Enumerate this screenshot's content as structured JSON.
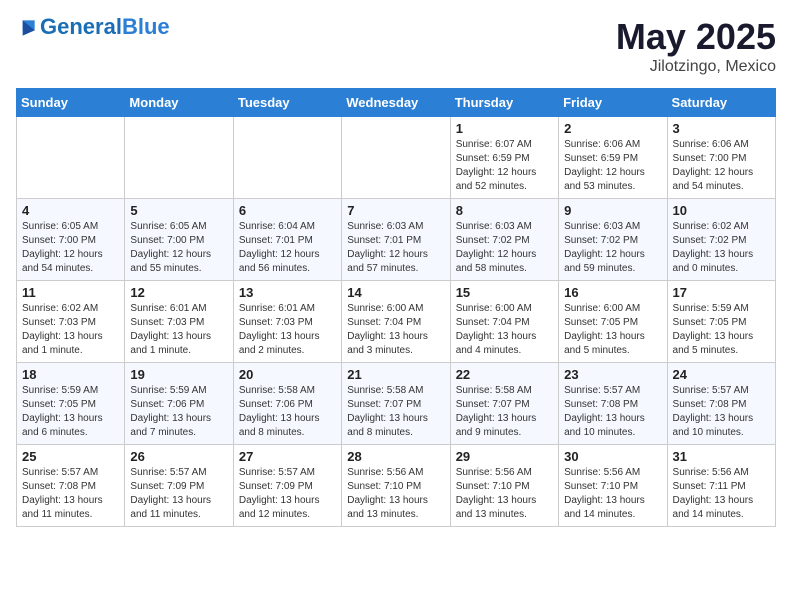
{
  "header": {
    "logo_general": "General",
    "logo_blue": "Blue",
    "month_year": "May 2025",
    "location": "Jilotzingo, Mexico"
  },
  "weekdays": [
    "Sunday",
    "Monday",
    "Tuesday",
    "Wednesday",
    "Thursday",
    "Friday",
    "Saturday"
  ],
  "weeks": [
    [
      {
        "day": "",
        "info": ""
      },
      {
        "day": "",
        "info": ""
      },
      {
        "day": "",
        "info": ""
      },
      {
        "day": "",
        "info": ""
      },
      {
        "day": "1",
        "info": "Sunrise: 6:07 AM\nSunset: 6:59 PM\nDaylight: 12 hours and 52 minutes."
      },
      {
        "day": "2",
        "info": "Sunrise: 6:06 AM\nSunset: 6:59 PM\nDaylight: 12 hours and 53 minutes."
      },
      {
        "day": "3",
        "info": "Sunrise: 6:06 AM\nSunset: 7:00 PM\nDaylight: 12 hours and 54 minutes."
      }
    ],
    [
      {
        "day": "4",
        "info": "Sunrise: 6:05 AM\nSunset: 7:00 PM\nDaylight: 12 hours and 54 minutes."
      },
      {
        "day": "5",
        "info": "Sunrise: 6:05 AM\nSunset: 7:00 PM\nDaylight: 12 hours and 55 minutes."
      },
      {
        "day": "6",
        "info": "Sunrise: 6:04 AM\nSunset: 7:01 PM\nDaylight: 12 hours and 56 minutes."
      },
      {
        "day": "7",
        "info": "Sunrise: 6:03 AM\nSunset: 7:01 PM\nDaylight: 12 hours and 57 minutes."
      },
      {
        "day": "8",
        "info": "Sunrise: 6:03 AM\nSunset: 7:02 PM\nDaylight: 12 hours and 58 minutes."
      },
      {
        "day": "9",
        "info": "Sunrise: 6:03 AM\nSunset: 7:02 PM\nDaylight: 12 hours and 59 minutes."
      },
      {
        "day": "10",
        "info": "Sunrise: 6:02 AM\nSunset: 7:02 PM\nDaylight: 13 hours and 0 minutes."
      }
    ],
    [
      {
        "day": "11",
        "info": "Sunrise: 6:02 AM\nSunset: 7:03 PM\nDaylight: 13 hours and 1 minute."
      },
      {
        "day": "12",
        "info": "Sunrise: 6:01 AM\nSunset: 7:03 PM\nDaylight: 13 hours and 1 minute."
      },
      {
        "day": "13",
        "info": "Sunrise: 6:01 AM\nSunset: 7:03 PM\nDaylight: 13 hours and 2 minutes."
      },
      {
        "day": "14",
        "info": "Sunrise: 6:00 AM\nSunset: 7:04 PM\nDaylight: 13 hours and 3 minutes."
      },
      {
        "day": "15",
        "info": "Sunrise: 6:00 AM\nSunset: 7:04 PM\nDaylight: 13 hours and 4 minutes."
      },
      {
        "day": "16",
        "info": "Sunrise: 6:00 AM\nSunset: 7:05 PM\nDaylight: 13 hours and 5 minutes."
      },
      {
        "day": "17",
        "info": "Sunrise: 5:59 AM\nSunset: 7:05 PM\nDaylight: 13 hours and 5 minutes."
      }
    ],
    [
      {
        "day": "18",
        "info": "Sunrise: 5:59 AM\nSunset: 7:05 PM\nDaylight: 13 hours and 6 minutes."
      },
      {
        "day": "19",
        "info": "Sunrise: 5:59 AM\nSunset: 7:06 PM\nDaylight: 13 hours and 7 minutes."
      },
      {
        "day": "20",
        "info": "Sunrise: 5:58 AM\nSunset: 7:06 PM\nDaylight: 13 hours and 8 minutes."
      },
      {
        "day": "21",
        "info": "Sunrise: 5:58 AM\nSunset: 7:07 PM\nDaylight: 13 hours and 8 minutes."
      },
      {
        "day": "22",
        "info": "Sunrise: 5:58 AM\nSunset: 7:07 PM\nDaylight: 13 hours and 9 minutes."
      },
      {
        "day": "23",
        "info": "Sunrise: 5:57 AM\nSunset: 7:08 PM\nDaylight: 13 hours and 10 minutes."
      },
      {
        "day": "24",
        "info": "Sunrise: 5:57 AM\nSunset: 7:08 PM\nDaylight: 13 hours and 10 minutes."
      }
    ],
    [
      {
        "day": "25",
        "info": "Sunrise: 5:57 AM\nSunset: 7:08 PM\nDaylight: 13 hours and 11 minutes."
      },
      {
        "day": "26",
        "info": "Sunrise: 5:57 AM\nSunset: 7:09 PM\nDaylight: 13 hours and 11 minutes."
      },
      {
        "day": "27",
        "info": "Sunrise: 5:57 AM\nSunset: 7:09 PM\nDaylight: 13 hours and 12 minutes."
      },
      {
        "day": "28",
        "info": "Sunrise: 5:56 AM\nSunset: 7:10 PM\nDaylight: 13 hours and 13 minutes."
      },
      {
        "day": "29",
        "info": "Sunrise: 5:56 AM\nSunset: 7:10 PM\nDaylight: 13 hours and 13 minutes."
      },
      {
        "day": "30",
        "info": "Sunrise: 5:56 AM\nSunset: 7:10 PM\nDaylight: 13 hours and 14 minutes."
      },
      {
        "day": "31",
        "info": "Sunrise: 5:56 AM\nSunset: 7:11 PM\nDaylight: 13 hours and 14 minutes."
      }
    ]
  ]
}
